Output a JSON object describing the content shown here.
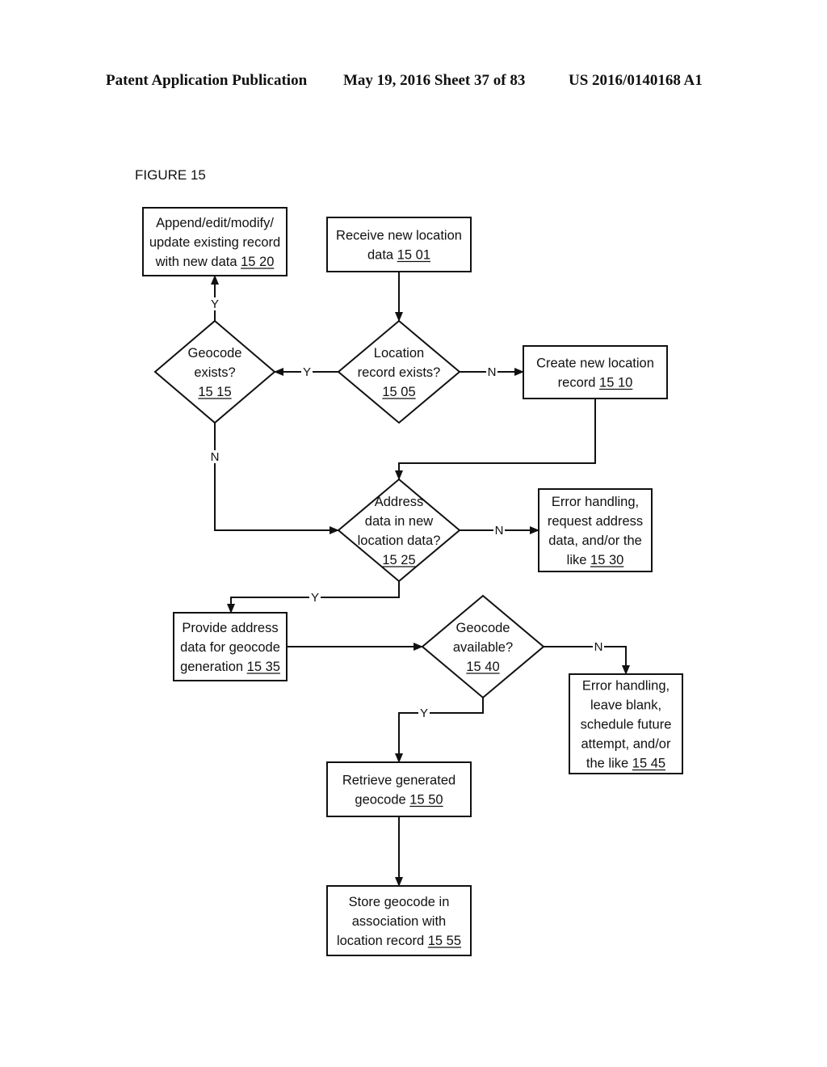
{
  "header": {
    "left": "Patent Application Publication",
    "date_sheet": "May 19, 2016  Sheet 37 of 83",
    "number": "US 2016/0140168 A1"
  },
  "figure": {
    "title": "FIGURE 15",
    "nodes": [
      {
        "id": "1501",
        "kind": "process",
        "lines": [
          "Receive new location"
        ],
        "last_prefix": "data ",
        "ref": "15 01"
      },
      {
        "id": "1505",
        "kind": "decision",
        "lines": [
          "Location",
          "record exists?"
        ],
        "last_prefix": "",
        "ref": "15 05"
      },
      {
        "id": "1510",
        "kind": "process",
        "lines": [
          "Create new location"
        ],
        "last_prefix": "record  ",
        "ref": "15 10"
      },
      {
        "id": "1515",
        "kind": "decision",
        "lines": [
          "Geocode",
          "exists?"
        ],
        "last_prefix": "",
        "ref": "15 15"
      },
      {
        "id": "1520",
        "kind": "process",
        "lines": [
          "Append/edit/modify/",
          "update  existing record"
        ],
        "last_prefix": "with new data ",
        "ref": "15 20"
      },
      {
        "id": "1525",
        "kind": "decision",
        "lines": [
          "Address",
          "data in new",
          "location data?"
        ],
        "last_prefix": "",
        "ref": "15 25"
      },
      {
        "id": "1530",
        "kind": "process",
        "lines": [
          "Error handling,",
          "request address",
          "data, and/or the"
        ],
        "last_prefix": "like  ",
        "ref": "15 30"
      },
      {
        "id": "1535",
        "kind": "process",
        "lines": [
          "Provide address",
          "data for geocode"
        ],
        "last_prefix": "generation ",
        "ref": "15 35"
      },
      {
        "id": "1540",
        "kind": "decision",
        "lines": [
          "Geocode",
          "available?"
        ],
        "last_prefix": "",
        "ref": "15 40"
      },
      {
        "id": "1545",
        "kind": "process",
        "lines": [
          "Error handling,",
          "leave blank,",
          "schedule future",
          "attempt, and/or"
        ],
        "last_prefix": "the like  ",
        "ref": "15 45"
      },
      {
        "id": "1550",
        "kind": "process",
        "lines": [
          "Retrieve generated"
        ],
        "last_prefix": "geocode ",
        "ref": "15 50"
      },
      {
        "id": "1555",
        "kind": "process",
        "lines": [
          "Store geocode in",
          "association with"
        ],
        "last_prefix": "location record ",
        "ref": "15 55"
      }
    ],
    "edges": [
      {
        "from": "1501",
        "to": "1505",
        "label": ""
      },
      {
        "from": "1505",
        "to": "1515",
        "label": "Y"
      },
      {
        "from": "1505",
        "to": "1510",
        "label": "N"
      },
      {
        "from": "1515",
        "to": "1520",
        "label": "Y"
      },
      {
        "from": "1515",
        "to": "1525",
        "label": "N"
      },
      {
        "from": "1510",
        "to": "1525",
        "label": ""
      },
      {
        "from": "1525",
        "to": "1530",
        "label": "N"
      },
      {
        "from": "1525",
        "to": "1535",
        "label": "Y"
      },
      {
        "from": "1535",
        "to": "1540",
        "label": ""
      },
      {
        "from": "1540",
        "to": "1545",
        "label": "N"
      },
      {
        "from": "1540",
        "to": "1550",
        "label": "Y"
      },
      {
        "from": "1550",
        "to": "1555",
        "label": ""
      }
    ]
  }
}
